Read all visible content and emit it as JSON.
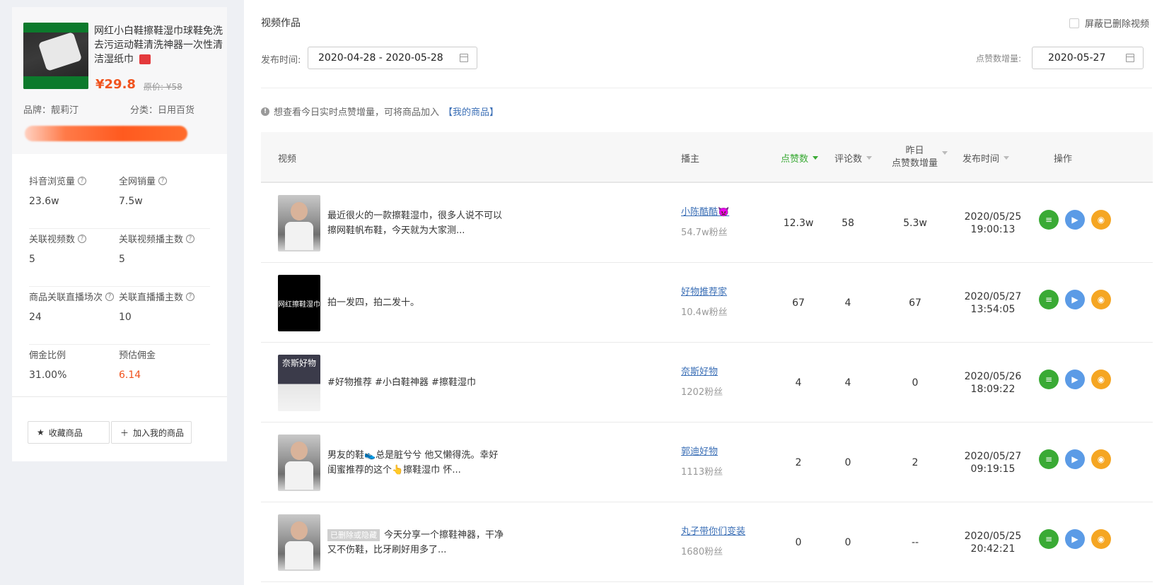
{
  "product": {
    "title": "网红小白鞋擦鞋湿巾球鞋免洗去污运动鞋清洗神器一次性清洁湿纸巾",
    "price": "¥29.8",
    "original_price": "原价: ¥58",
    "brand": "品牌：靓莉汀",
    "category": "分类：日用百货"
  },
  "stats": [
    [
      {
        "label": "抖音浏览量",
        "value": "23.6w",
        "help": true
      },
      {
        "label": "全网销量",
        "value": "7.5w",
        "help": true
      }
    ],
    [
      {
        "label": "关联视频数",
        "value": "5",
        "help": true
      },
      {
        "label": "关联视频播主数",
        "value": "5",
        "help": true
      }
    ],
    [
      {
        "label": "商品关联直播场次",
        "value": "24",
        "help": true
      },
      {
        "label": "关联直播播主数",
        "value": "10",
        "help": true
      }
    ],
    [
      {
        "label": "佣金比例",
        "value": "31.00%",
        "help": false
      },
      {
        "label": "预估佣金",
        "value": "6.14",
        "help": false
      }
    ]
  ],
  "buttons": {
    "favorite": "收藏商品",
    "add_mine": "加入我的商品"
  },
  "section": {
    "title": "视频作品",
    "hide_deleted": "屏蔽已删除视频",
    "publish_label": "发布时间:",
    "date_range": "2020-04-28 - 2020-05-28",
    "likes_inc_label": "点赞数增量:",
    "likes_inc_date": "2020-05-27",
    "tip_text": "想查看今日实时点赞增量，可将商品加入",
    "tip_link": "【我的商品】"
  },
  "table": {
    "headers": {
      "video": "视频",
      "creator": "播主",
      "likes": "点赞数",
      "comments": "评论数",
      "yesterday_line1": "昨日",
      "yesterday_line2": "点赞数增量",
      "publish": "发布时间",
      "ops": "操作"
    },
    "rows": [
      {
        "thumb": "person",
        "thumb_text": "",
        "deleted_tag": "",
        "desc": "最近很火的一款擦鞋湿巾，很多人说不可以擦网鞋帆布鞋，今天就为大家测...",
        "creator": "小陈酷酷👿",
        "fans": "54.7w粉丝",
        "likes": "12.3w",
        "comments": "58",
        "yesterday": "5.3w",
        "date": "2020/05/25",
        "time": "19:00:13"
      },
      {
        "thumb": "black",
        "thumb_text": "网红擦鞋湿巾",
        "deleted_tag": "",
        "desc": "拍一发四，拍二发十。",
        "creator": "好物推荐家",
        "fans": "10.4w粉丝",
        "likes": "67",
        "comments": "4",
        "yesterday": "67",
        "date": "2020/05/27",
        "time": "13:54:05"
      },
      {
        "thumb": "split",
        "thumb_text": "奈斯好物",
        "deleted_tag": "",
        "desc": "#好物推荐 #小白鞋神器 #擦鞋湿巾",
        "creator": "奈斯好物",
        "fans": "1202粉丝",
        "likes": "4",
        "comments": "4",
        "yesterday": "0",
        "date": "2020/05/26",
        "time": "18:09:22"
      },
      {
        "thumb": "person",
        "thumb_text": "",
        "deleted_tag": "",
        "desc": "男友的鞋👟总是脏兮兮 他又懒得洗。幸好闺蜜推荐的这个👆擦鞋湿巾 怀...",
        "creator": "郭迪好物",
        "fans": "1113粉丝",
        "likes": "2",
        "comments": "0",
        "yesterday": "2",
        "date": "2020/05/27",
        "time": "09:19:15"
      },
      {
        "thumb": "person",
        "thumb_text": "",
        "deleted_tag": "已删除或隐藏",
        "desc": "今天分享一个擦鞋神器，干净又不伤鞋，比牙刷好用多了...",
        "creator": "丸子带你们变装",
        "fans": "1680粉丝",
        "likes": "0",
        "comments": "0",
        "yesterday": "--",
        "date": "2020/05/25",
        "time": "20:42:21"
      }
    ]
  },
  "colors": {
    "accent_green": "#3aaa35",
    "link_blue": "#3b6fb6",
    "price_orange": "#f0531e",
    "op_blue": "#5b9be6",
    "op_orange": "#f5a623"
  }
}
